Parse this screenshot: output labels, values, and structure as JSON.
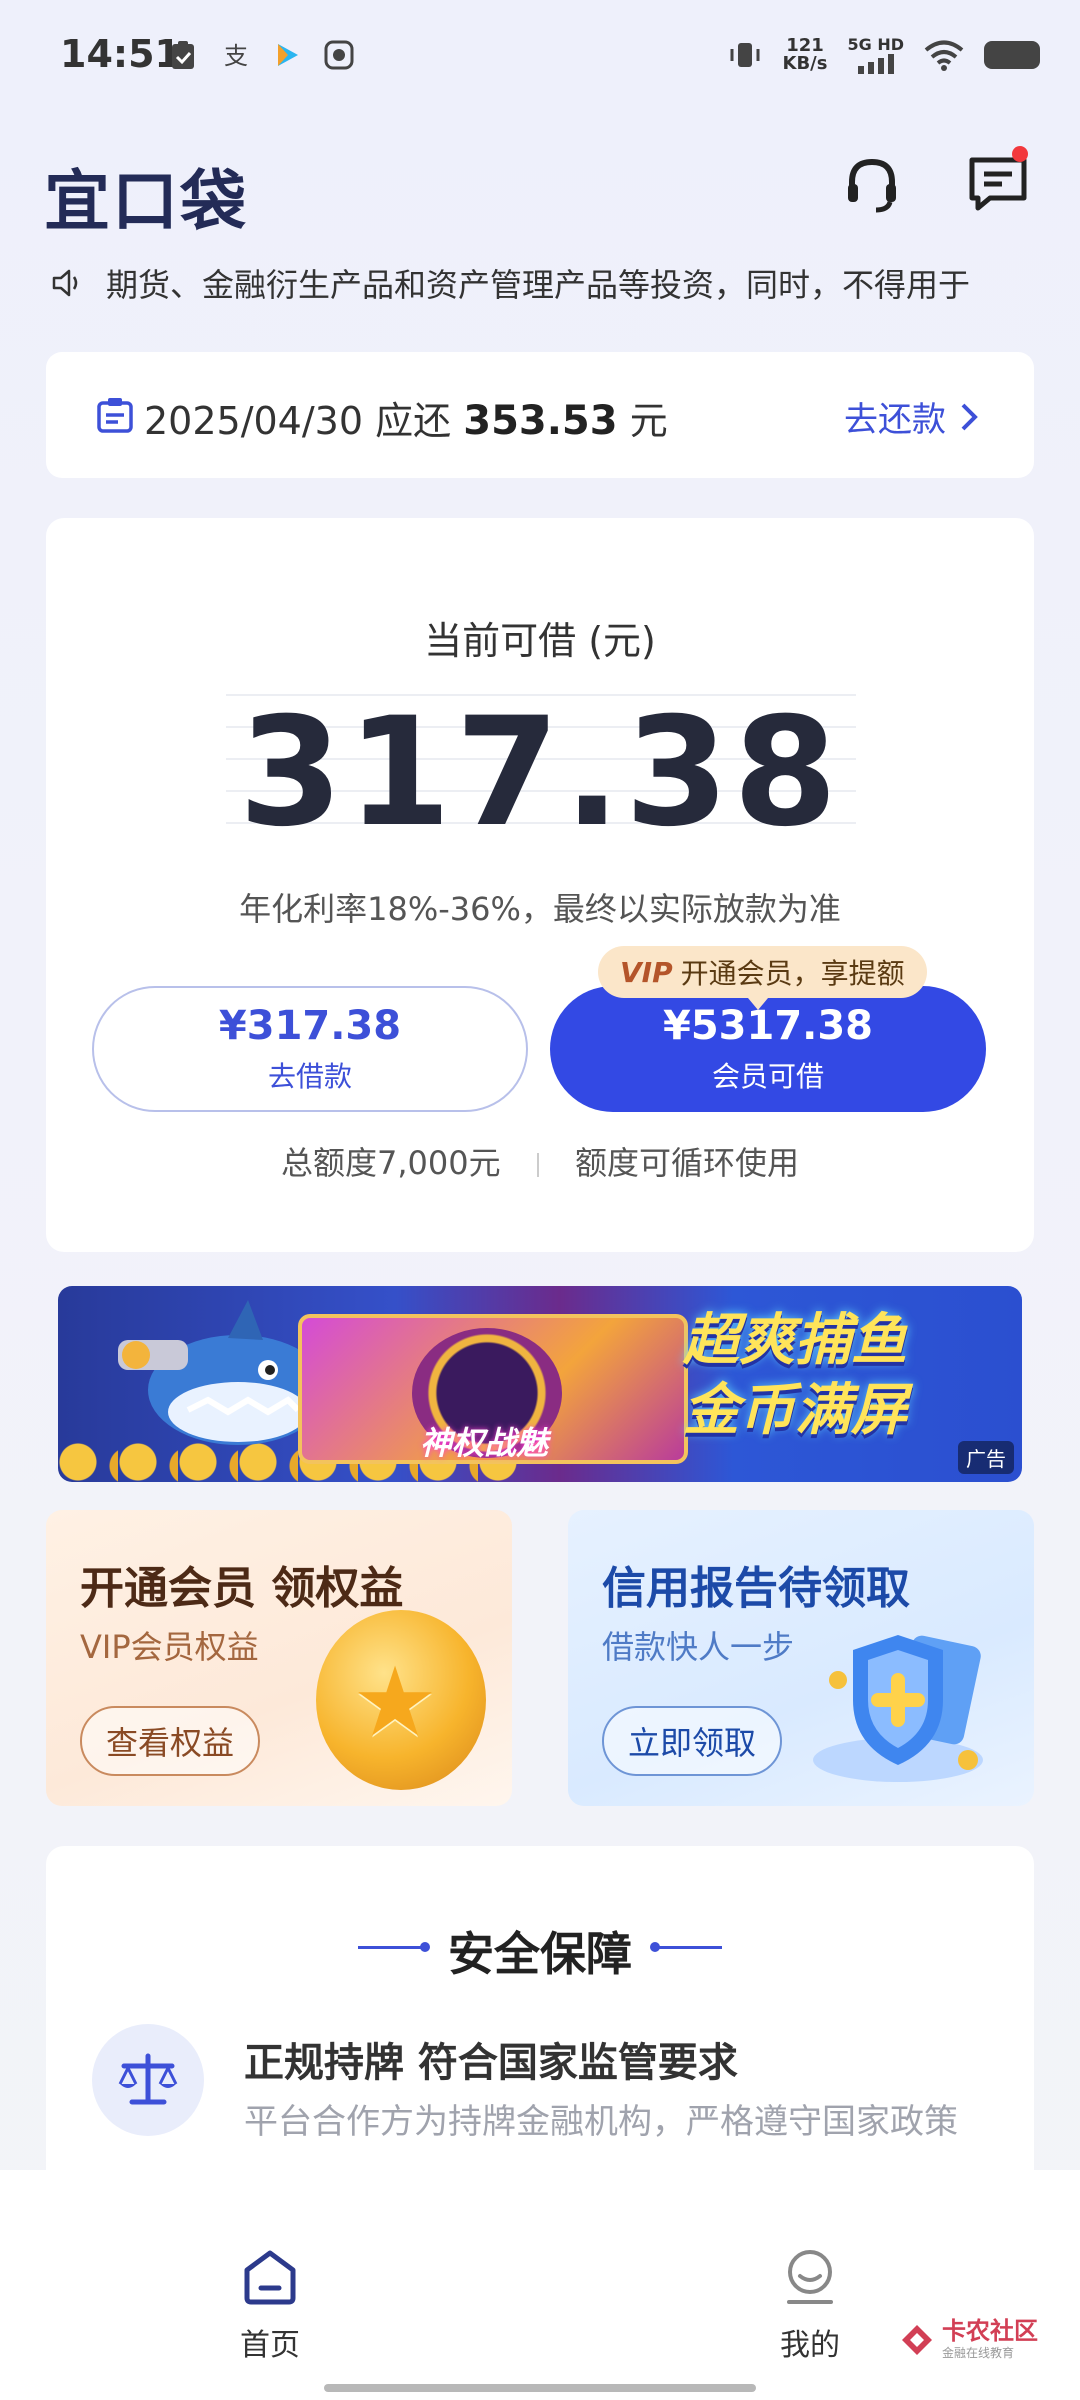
{
  "status_bar": {
    "time": "14:51",
    "speed_value": "121",
    "speed_unit": "KB/s",
    "network": "5G HD"
  },
  "header": {
    "logo": "宜口袋"
  },
  "notice": {
    "text": "期货、金融衍生产品和资产管理产品等投资，同时，不得用于"
  },
  "repay": {
    "date": "2025/04/30",
    "label": "应还",
    "amount": "353.53",
    "unit": "元",
    "action": "去还款"
  },
  "credit": {
    "label": "当前可借 (元)",
    "amount": "317.38",
    "rate_note": "年化利率18%-36%，最终以实际放款为准",
    "borrow_value": "¥317.38",
    "borrow_label": "去借款",
    "vip_value": "¥5317.38",
    "vip_label": "会员可借",
    "vip_tag_badge": "VIP",
    "vip_tag_text": "开通会员，享提额",
    "quota_total": "总额度7,000元",
    "quota_note": "额度可循环使用"
  },
  "ad": {
    "game_word": "神权战魅",
    "slogan_line1": "超爽捕鱼",
    "slogan_line2": "金币满屏",
    "tag": "广告"
  },
  "promos": {
    "vip": {
      "title": "开通会员 领权益",
      "subtitle": "VIP会员权益",
      "button": "查看权益"
    },
    "credit": {
      "title": "信用报告待领取",
      "subtitle": "借款快人一步",
      "button": "立即领取"
    }
  },
  "security": {
    "title": "安全保障",
    "feature_title": "正规持牌 符合国家监管要求",
    "feature_desc": "平台合作方为持牌金融机构，严格遵守国家政策"
  },
  "nav": {
    "home": "首页",
    "mine": "我的"
  },
  "watermark": {
    "name": "卡农社区",
    "sub": "金融在线教育"
  },
  "colors": {
    "primary": "#3349e4",
    "accent_text": "#3d50d8",
    "logo": "#232b57",
    "notification_dot": "#f2383d"
  }
}
